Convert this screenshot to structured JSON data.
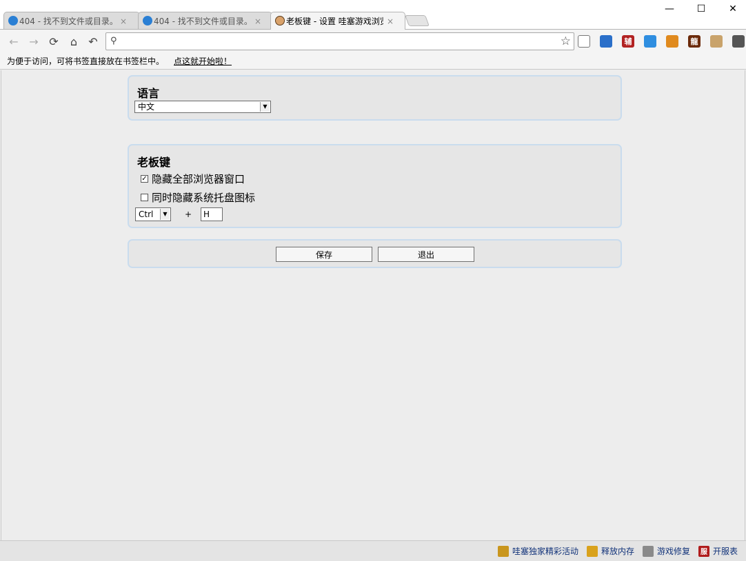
{
  "tabs": [
    {
      "title": "404 - 找不到文件或目录。",
      "active": false
    },
    {
      "title": "404 - 找不到文件或目录。",
      "active": false
    },
    {
      "title": "老板键 - 设置 哇塞游戏浏览器",
      "active": true
    }
  ],
  "tab_close_glyph": "×",
  "window": {
    "minimize": "—",
    "maximize": "☐",
    "close": "✕"
  },
  "toolbar": {
    "address_value": "",
    "address_placeholder": "",
    "extensions": [
      {
        "icon": "window-icon",
        "text": "",
        "color": "#ffffff"
      },
      {
        "icon": "puzzle-icon",
        "text": "",
        "color": "#2a6fc9"
      },
      {
        "icon": "fu-icon",
        "text": "辅",
        "color": "#b22222"
      },
      {
        "icon": "gear-icon",
        "text": "",
        "color": "#2f8ee0"
      },
      {
        "icon": "game-icon",
        "text": "",
        "color": "#e08a1e"
      },
      {
        "icon": "dragon-icon",
        "text": "龍",
        "color": "#6b2a0a"
      },
      {
        "icon": "user-icon",
        "text": "",
        "color": "#c9a36b"
      },
      {
        "icon": "wrench-icon",
        "text": "",
        "color": "#555555"
      }
    ]
  },
  "bookmarkbar": {
    "hint": "为便于访问，可将书签直接放在书签栏中。",
    "link": "点这就开始啦！"
  },
  "language_panel": {
    "title": "语言",
    "selected": "中文"
  },
  "bosskey_panel": {
    "title": "老板键",
    "options": [
      {
        "label": "隐藏全部浏览器窗口",
        "checked": true
      },
      {
        "label": "同时隐藏系统托盘图标",
        "checked": false
      }
    ],
    "modifier": "Ctrl",
    "plus": "+",
    "key": "H"
  },
  "actions": {
    "save": "保存",
    "exit": "退出"
  },
  "statusbar": {
    "items": [
      {
        "label": "哇塞独家精彩活动",
        "icon": "trophy-icon",
        "color": "#c9961e",
        "glyph": ""
      },
      {
        "label": "释放内存",
        "icon": "broom-icon",
        "color": "#d9a21c",
        "glyph": ""
      },
      {
        "label": "游戏修复",
        "icon": "tools-icon",
        "color": "#8a8a8a",
        "glyph": ""
      },
      {
        "label": "开服表",
        "icon": "server-list-icon",
        "color": "#b01c1c",
        "glyph": "服"
      }
    ]
  }
}
